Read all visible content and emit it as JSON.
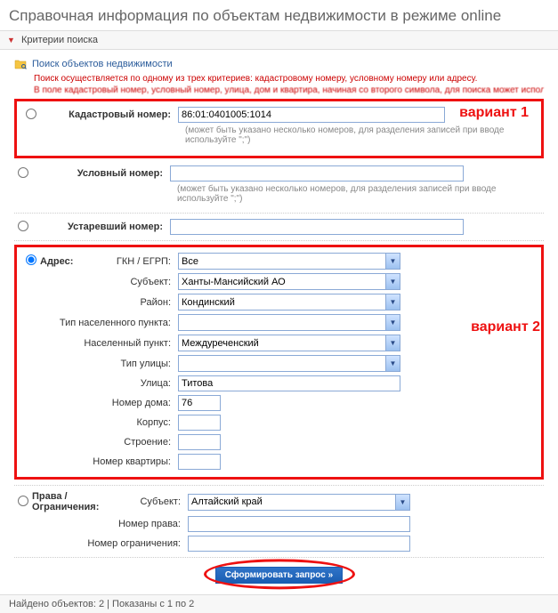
{
  "page_title": "Справочная информация по объектам недвижимости в режиме online",
  "criteria_header": "Критерии поиска",
  "search_header": "Поиск объектов недвижимости",
  "red_note": "Поиск осуществляется по одному из трех критериев: кадастровому номеру, условному номеру или адресу.",
  "red_obscured": "В поле кадастровый номер, условный номер, улица, дом и квартира, начиная со второго символа, для поиска может использоваться символ *",
  "variant1_label": "вариант 1",
  "variant2_label": "вариант 2",
  "cadastral": {
    "label": "Кадастровый номер:",
    "value": "86:01:0401005:1014",
    "hint": "(может быть указано несколько номеров, для разделения записей при вводе используйте \";\")"
  },
  "conditional": {
    "label": "Условный номер:",
    "value": "",
    "hint": "(может быть указано несколько номеров, для разделения записей при вводе используйте \";\")"
  },
  "old_number": {
    "label": "Устаревший номер:",
    "value": ""
  },
  "address": {
    "radio_label": "Адрес:",
    "gkn_label": "ГКН / ЕГРП:",
    "gkn_value": "Все",
    "subject_label": "Субъект:",
    "subject_value": "Ханты-Мансийский АО",
    "district_label": "Район:",
    "district_value": "Кондинский",
    "settlement_type_label": "Тип населенного пункта:",
    "settlement_type_value": "",
    "settlement_label": "Населенный пункт:",
    "settlement_value": "Междуреченский",
    "street_type_label": "Тип улицы:",
    "street_type_value": "",
    "street_label": "Улица:",
    "street_value": "Титова",
    "house_label": "Номер дома:",
    "house_value": "76",
    "building_label": "Корпус:",
    "building_value": "",
    "structure_label": "Строение:",
    "structure_value": "",
    "flat_label": "Номер квартиры:",
    "flat_value": ""
  },
  "rights": {
    "radio_label": "Права / Ограничения:",
    "subject_label": "Субъект:",
    "subject_value": "Алтайский край",
    "right_no_label": "Номер права:",
    "right_no_value": "",
    "limit_no_label": "Номер ограничения:",
    "limit_no_value": ""
  },
  "submit_label": "Сформировать запрос »",
  "footer_text": "Найдено объектов: 2 | Показаны с 1 по 2"
}
